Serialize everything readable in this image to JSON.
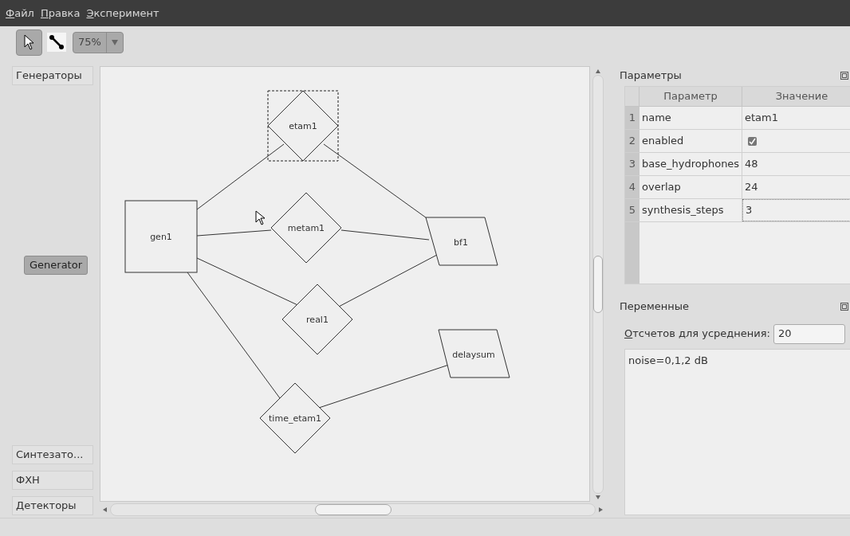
{
  "menu": [
    "Файл",
    "Правка",
    "Эксперимент"
  ],
  "toolbar": {
    "tools": [
      {
        "kind": "pointer",
        "selected": true
      },
      {
        "kind": "connector",
        "selected": false
      }
    ],
    "zoom": "75%"
  },
  "sidebar": {
    "categories_top": [
      {
        "label": "Генераторы"
      }
    ],
    "palette": [
      {
        "label": "Generator"
      }
    ],
    "categories_bottom": [
      {
        "label": "Синтезато..."
      },
      {
        "label": "ФХН"
      },
      {
        "label": "Детекторы"
      }
    ]
  },
  "diagram": {
    "nodes": [
      {
        "kind": "diamond",
        "label": "etam1",
        "selected": true
      },
      {
        "kind": "rect",
        "label": "gen1",
        "selected": false
      },
      {
        "kind": "diamond",
        "label": "metam1",
        "selected": false
      },
      {
        "kind": "parallelogram",
        "label": "bf1",
        "selected": false
      },
      {
        "kind": "diamond",
        "label": "real1",
        "selected": false
      },
      {
        "kind": "parallelogram",
        "label": "delaysum",
        "selected": false
      },
      {
        "kind": "diamond",
        "label": "time_etam1",
        "selected": false
      }
    ]
  },
  "parameters": {
    "title": "Параметры",
    "columns": [
      "Параметр",
      "Значение"
    ],
    "rows": [
      {
        "number": "1",
        "name": "name",
        "kind": "text",
        "value": "etam1",
        "focused": false
      },
      {
        "number": "2",
        "name": "enabled",
        "kind": "check",
        "checked": true,
        "focused": false
      },
      {
        "number": "3",
        "name": "base_hydrophones",
        "kind": "text",
        "value": "48",
        "focused": false
      },
      {
        "number": "4",
        "name": "overlap",
        "kind": "text",
        "value": "24",
        "focused": false
      },
      {
        "number": "5",
        "name": "synthesis_steps",
        "kind": "text",
        "value": "3",
        "focused": true
      }
    ]
  },
  "variables": {
    "title": "Переменные",
    "spin_label": "Отсчетов для усреднения:",
    "spin_value": "20",
    "text": "noise=0,1,2 dB"
  }
}
